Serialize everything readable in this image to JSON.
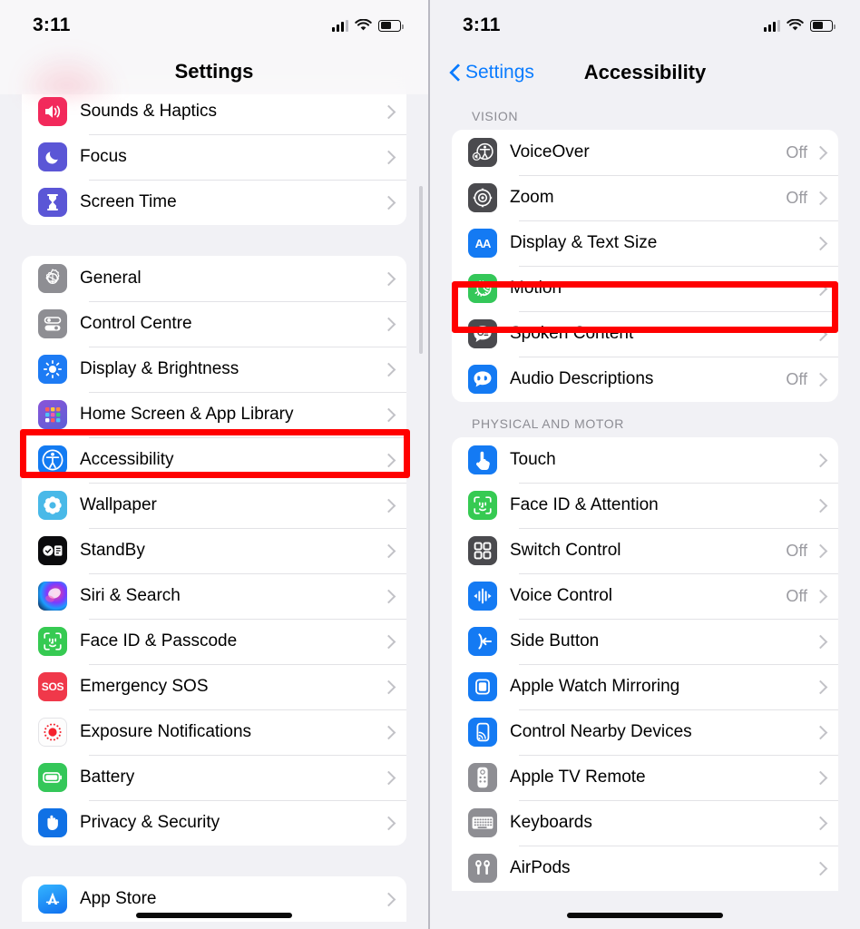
{
  "statusbar": {
    "time": "3:11",
    "signal_icon": "cellular-signal-icon",
    "wifi_icon": "wifi-icon",
    "battery_icon": "battery-icon",
    "battery_level_pct": 58
  },
  "left_panel": {
    "title": "Settings",
    "groups": [
      {
        "id": "group-notifications",
        "partial_top": true,
        "rows": [
          {
            "label": "Sounds & Haptics",
            "icon": "sounds-haptics-icon",
            "value": "",
            "chevron": true
          },
          {
            "label": "Focus",
            "icon": "focus-icon",
            "value": "",
            "chevron": true
          },
          {
            "label": "Screen Time",
            "icon": "screen-time-icon",
            "value": "",
            "chevron": true
          }
        ]
      },
      {
        "id": "group-system",
        "rows": [
          {
            "label": "General",
            "icon": "general-gear-icon",
            "value": "",
            "chevron": true
          },
          {
            "label": "Control Centre",
            "icon": "control-centre-icon",
            "value": "",
            "chevron": true
          },
          {
            "label": "Display & Brightness",
            "icon": "display-brightness-icon",
            "value": "",
            "chevron": true
          },
          {
            "label": "Home Screen & App Library",
            "icon": "home-screen-icon",
            "value": "",
            "chevron": true
          },
          {
            "label": "Accessibility",
            "icon": "accessibility-icon",
            "value": "",
            "chevron": true,
            "highlighted": true
          },
          {
            "label": "Wallpaper",
            "icon": "wallpaper-icon",
            "value": "",
            "chevron": true
          },
          {
            "label": "StandBy",
            "icon": "standby-icon",
            "value": "",
            "chevron": true
          },
          {
            "label": "Siri & Search",
            "icon": "siri-search-icon",
            "value": "",
            "chevron": true
          },
          {
            "label": "Face ID & Passcode",
            "icon": "face-id-icon",
            "value": "",
            "chevron": true
          },
          {
            "label": "Emergency SOS",
            "icon": "emergency-sos-icon",
            "value": "",
            "chevron": true
          },
          {
            "label": "Exposure Notifications",
            "icon": "exposure-notifications-icon",
            "value": "",
            "chevron": true
          },
          {
            "label": "Battery",
            "icon": "battery-settings-icon",
            "value": "",
            "chevron": true
          },
          {
            "label": "Privacy & Security",
            "icon": "privacy-security-icon",
            "value": "",
            "chevron": true
          }
        ]
      },
      {
        "id": "group-store",
        "partial_bottom": true,
        "rows": [
          {
            "label": "App Store",
            "icon": "app-store-icon",
            "value": "",
            "chevron": true
          }
        ]
      }
    ]
  },
  "right_panel": {
    "back_label": "Settings",
    "title": "Accessibility",
    "sections": [
      {
        "header": "VISION",
        "rows": [
          {
            "label": "VoiceOver",
            "icon": "voiceover-icon",
            "value": "Off",
            "chevron": true
          },
          {
            "label": "Zoom",
            "icon": "zoom-icon",
            "value": "Off",
            "chevron": true
          },
          {
            "label": "Display & Text Size",
            "icon": "display-text-size-icon",
            "value": "",
            "chevron": true
          },
          {
            "label": "Motion",
            "icon": "motion-icon",
            "value": "",
            "chevron": true,
            "highlighted": true
          },
          {
            "label": "Spoken Content",
            "icon": "spoken-content-icon",
            "value": "",
            "chevron": true
          },
          {
            "label": "Audio Descriptions",
            "icon": "audio-descriptions-icon",
            "value": "Off",
            "chevron": true
          }
        ]
      },
      {
        "header": "PHYSICAL AND MOTOR",
        "rows": [
          {
            "label": "Touch",
            "icon": "touch-icon",
            "value": "",
            "chevron": true
          },
          {
            "label": "Face ID & Attention",
            "icon": "face-id-attention-icon",
            "value": "",
            "chevron": true
          },
          {
            "label": "Switch Control",
            "icon": "switch-control-icon",
            "value": "Off",
            "chevron": true
          },
          {
            "label": "Voice Control",
            "icon": "voice-control-icon",
            "value": "Off",
            "chevron": true
          },
          {
            "label": "Side Button",
            "icon": "side-button-icon",
            "value": "",
            "chevron": true
          },
          {
            "label": "Apple Watch Mirroring",
            "icon": "apple-watch-mirroring-icon",
            "value": "",
            "chevron": true
          },
          {
            "label": "Control Nearby Devices",
            "icon": "control-nearby-devices-icon",
            "value": "",
            "chevron": true
          },
          {
            "label": "Apple TV Remote",
            "icon": "apple-tv-remote-icon",
            "value": "",
            "chevron": true
          },
          {
            "label": "Keyboards",
            "icon": "keyboards-icon",
            "value": "",
            "chevron": true
          },
          {
            "label": "AirPods",
            "icon": "airpods-icon",
            "value": "",
            "chevron": true
          }
        ]
      }
    ]
  },
  "annotations": {
    "highlight_color": "#ff0000",
    "left_highlight_target": "Accessibility",
    "right_highlight_target": "Motion"
  }
}
